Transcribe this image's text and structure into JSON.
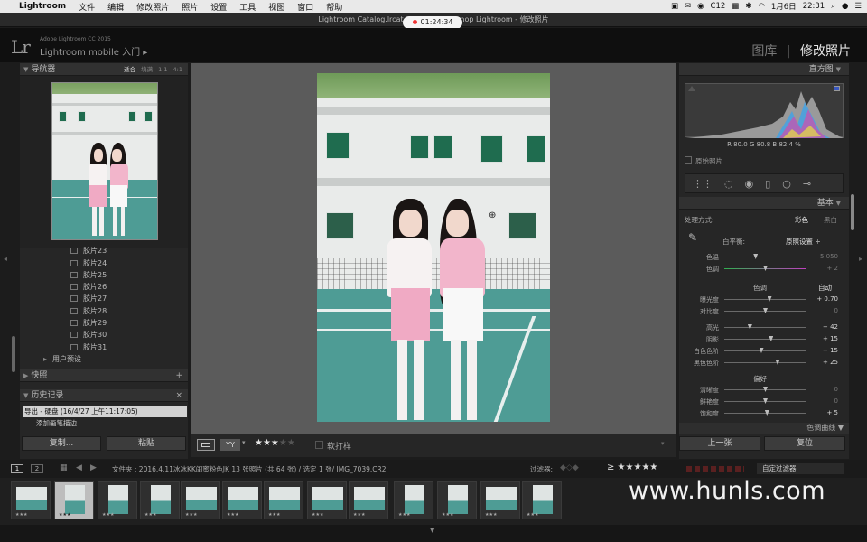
{
  "menubar": {
    "app": "Lightroom",
    "items": [
      "文件",
      "编辑",
      "修改照片",
      "照片",
      "设置",
      "工具",
      "视图",
      "窗口",
      "帮助"
    ],
    "right": {
      "extra": "C12",
      "date": "1月6日",
      "time": "22:31"
    }
  },
  "window": {
    "title": "Lightroom Catalog.lrcat - Adobe Photoshop Lightroom - 修改照片",
    "timer": "01:24:34"
  },
  "identity": {
    "line1": "Adobe Lightroom CC 2015",
    "line2": "Lightroom mobile 入门",
    "logo": "Lr"
  },
  "modules": {
    "library": "图库",
    "separator": "|",
    "develop": "修改照片"
  },
  "navigator": {
    "title": "导航器",
    "fit": "适合",
    "fill": "填满",
    "one": "1:1",
    "four": "4:1"
  },
  "presets": {
    "items": [
      "胶片23",
      "胶片24",
      "胶片25",
      "胶片26",
      "胶片27",
      "胶片28",
      "胶片29",
      "胶片30",
      "胶片31"
    ],
    "folder": "用户预设"
  },
  "snapshots": {
    "title": "快照",
    "add": "+"
  },
  "history": {
    "title": "历史记录",
    "close": "×",
    "items": [
      "导出 - 硬盘 (16/4/27 上午11:17:05)",
      "添加画笔描边"
    ]
  },
  "leftbuttons": {
    "copy": "复制...",
    "paste": "粘贴"
  },
  "toolbar": {
    "stars": "★★★",
    "dim_stars": "★★",
    "proof": "软打样",
    "yy": "YY"
  },
  "histogram": {
    "title": "直方图",
    "readout": "R 80.0  G 80.8  B 82.4 %",
    "original": "原始照片"
  },
  "basic": {
    "title": "基本",
    "treatment_label": "处理方式:",
    "color": "彩色",
    "bw": "黑白",
    "wb_label": "白平衡:",
    "wb_value": "原照设置",
    "tone_title": "色调",
    "auto": "自动",
    "presence_title": "偏好",
    "curve_title": "色调曲线",
    "sliders": [
      {
        "label": "色温",
        "value": "5,050",
        "dim": true
      },
      {
        "label": "色调",
        "value": "+ 2",
        "dim": true
      },
      {
        "label": "曝光度",
        "value": "+ 0.70",
        "dim": false
      },
      {
        "label": "对比度",
        "value": "0",
        "dim": true
      },
      {
        "label": "高光",
        "value": "− 42",
        "dim": false
      },
      {
        "label": "阴影",
        "value": "+ 15",
        "dim": false
      },
      {
        "label": "白色色阶",
        "value": "− 15",
        "dim": false
      },
      {
        "label": "黑色色阶",
        "value": "+ 25",
        "dim": false
      },
      {
        "label": "清晰度",
        "value": "0",
        "dim": true
      },
      {
        "label": "鲜艳度",
        "value": "0",
        "dim": true
      },
      {
        "label": "饱和度",
        "value": "+ 5",
        "dim": false
      }
    ]
  },
  "rightbuttons": {
    "prev": "上一张",
    "reset": "复位"
  },
  "stripbar": {
    "page1": "1",
    "page2": "2",
    "path": "文件夹 : 2016.4.11冰冰KK闺蜜粉色JK   13 张照片 (共 64 张) / 选定 1 张/ IMG_7039.CR2",
    "filter_label": "过滤器:",
    "filter_stars": "≥ ★★★★★",
    "custom": "自定过滤器"
  },
  "watermark": "www.hunls.com",
  "colors": {
    "accent": "#e9e9e9",
    "court": "#4e9c95",
    "skirt": "#f0aac4",
    "windows": "#1f6c4f"
  }
}
